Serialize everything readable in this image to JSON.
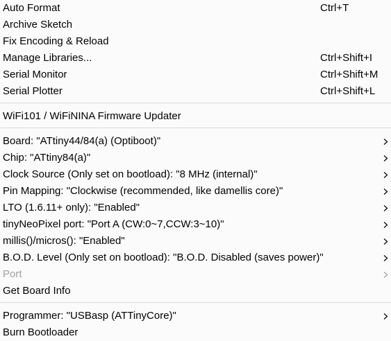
{
  "menu": {
    "groups": [
      {
        "items": [
          {
            "label": "Auto Format",
            "shortcut": "Ctrl+T",
            "submenu": false,
            "enabled": true
          },
          {
            "label": "Archive Sketch",
            "shortcut": "",
            "submenu": false,
            "enabled": true
          },
          {
            "label": "Fix Encoding & Reload",
            "shortcut": "",
            "submenu": false,
            "enabled": true
          },
          {
            "label": "Manage Libraries...",
            "shortcut": "Ctrl+Shift+I",
            "submenu": false,
            "enabled": true
          },
          {
            "label": "Serial Monitor",
            "shortcut": "Ctrl+Shift+M",
            "submenu": false,
            "enabled": true
          },
          {
            "label": "Serial Plotter",
            "shortcut": "Ctrl+Shift+L",
            "submenu": false,
            "enabled": true
          }
        ]
      },
      {
        "items": [
          {
            "label": "WiFi101 / WiFiNINA Firmware Updater",
            "shortcut": "",
            "submenu": false,
            "enabled": true
          }
        ]
      },
      {
        "items": [
          {
            "label": "Board: \"ATtiny44/84(a) (Optiboot)\"",
            "shortcut": "",
            "submenu": true,
            "enabled": true
          },
          {
            "label": "Chip: \"ATtiny84(a)\"",
            "shortcut": "",
            "submenu": true,
            "enabled": true
          },
          {
            "label": "Clock Source (Only set on bootload): \"8 MHz (internal)\"",
            "shortcut": "",
            "submenu": true,
            "enabled": true
          },
          {
            "label": "Pin Mapping: \"Clockwise (recommended, like damellis core)\"",
            "shortcut": "",
            "submenu": true,
            "enabled": true
          },
          {
            "label": "LTO (1.6.11+ only): \"Enabled\"",
            "shortcut": "",
            "submenu": true,
            "enabled": true
          },
          {
            "label": "tinyNeoPixel port: \"Port A (CW:0~7,CCW:3~10)\"",
            "shortcut": "",
            "submenu": true,
            "enabled": true
          },
          {
            "label": "millis()/micros(): \"Enabled\"",
            "shortcut": "",
            "submenu": true,
            "enabled": true
          },
          {
            "label": "B.O.D. Level (Only set on bootload): \"B.O.D. Disabled (saves power)\"",
            "shortcut": "",
            "submenu": true,
            "enabled": true
          },
          {
            "label": "Port",
            "shortcut": "",
            "submenu": true,
            "enabled": false
          },
          {
            "label": "Get Board Info",
            "shortcut": "",
            "submenu": false,
            "enabled": true
          }
        ]
      },
      {
        "items": [
          {
            "label": "Programmer: \"USBasp (ATTinyCore)\"",
            "shortcut": "",
            "submenu": true,
            "enabled": true
          },
          {
            "label": "Burn Bootloader",
            "shortcut": "",
            "submenu": false,
            "enabled": true
          }
        ]
      }
    ],
    "colors": {
      "background": "#fbfbfb",
      "text": "#000000",
      "disabled_text": "#a0a0a0",
      "separator": "#d9d9d9"
    },
    "icons": {
      "submenu": "chevron-right-icon"
    }
  }
}
